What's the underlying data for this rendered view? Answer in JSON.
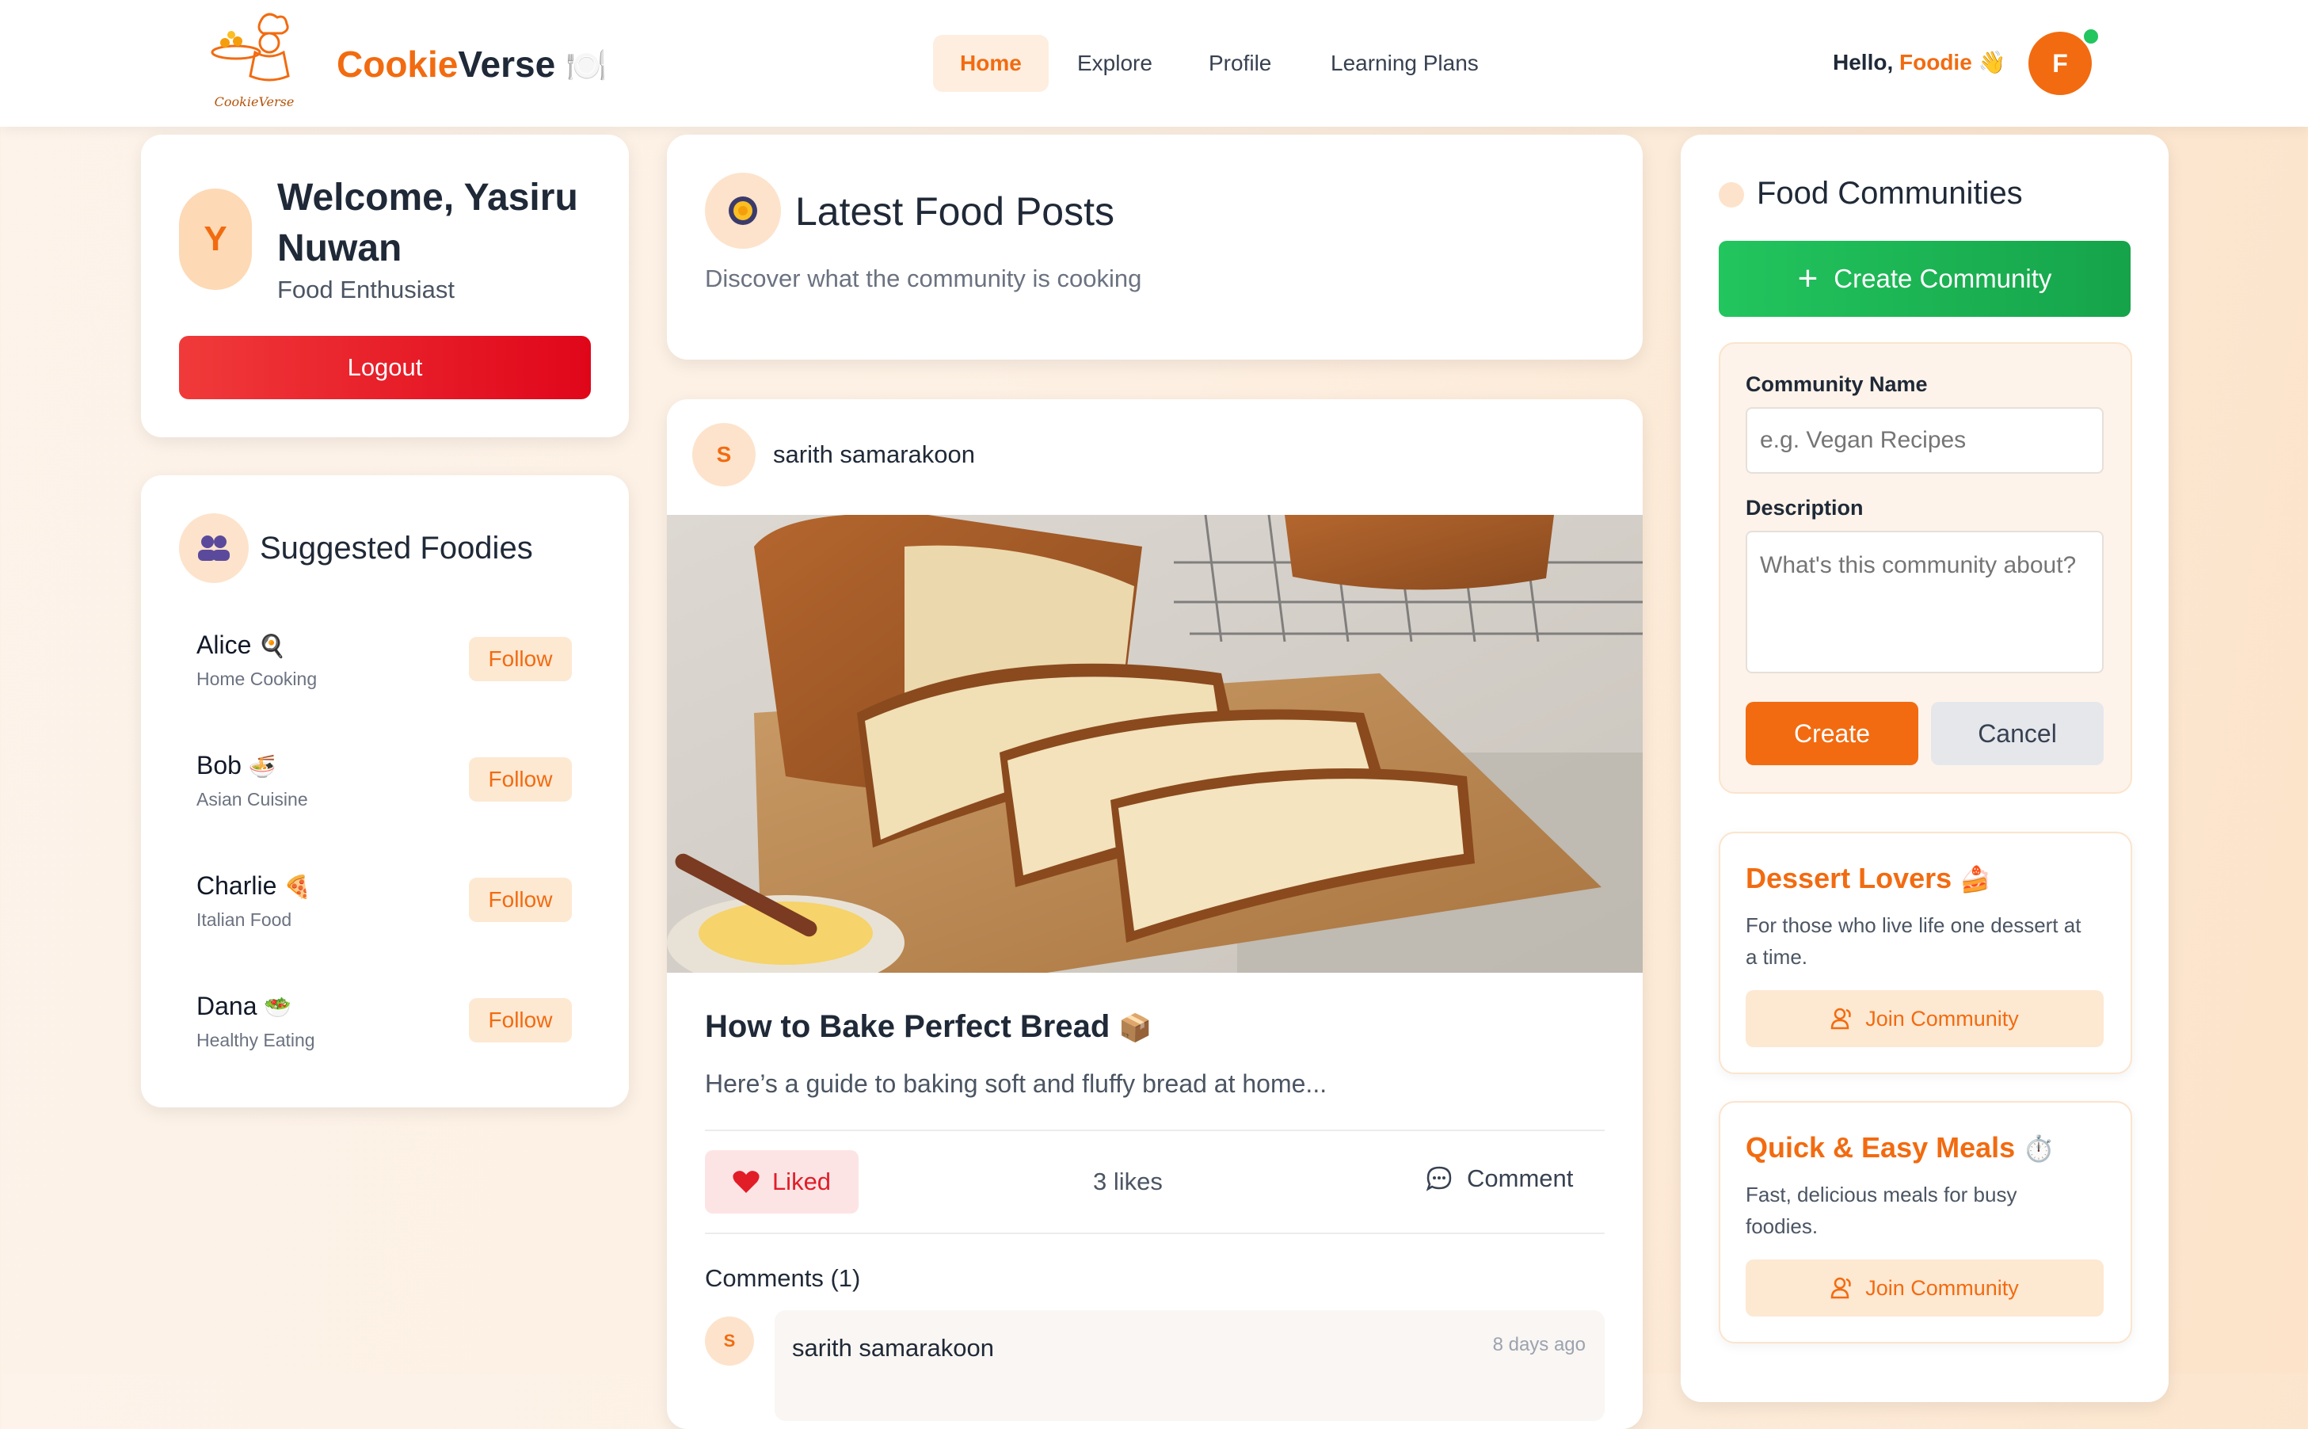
{
  "header": {
    "logo_caption": "CookieVerse",
    "brand_part1": "Cookie",
    "brand_part2": "Verse",
    "brand_emoji": "🍽️",
    "nav": [
      "Home",
      "Explore",
      "Profile",
      "Learning Plans"
    ],
    "greeting": "Hello,",
    "greeting_name": "Foodie",
    "greeting_emoji": "👋",
    "avatar_letter": "F"
  },
  "welcome": {
    "avatar_letter": "Y",
    "title": "Welcome, Yasiru Nuwan",
    "role": "Food Enthusiast",
    "logout": "Logout"
  },
  "suggested": {
    "title": "Suggested Foodies",
    "icon": "people-icon",
    "follow_label": "Follow",
    "items": [
      {
        "name": "Alice",
        "emoji": "🍳",
        "tag": "Home Cooking"
      },
      {
        "name": "Bob",
        "emoji": "🍜",
        "tag": "Asian Cuisine"
      },
      {
        "name": "Charlie",
        "emoji": "🍕",
        "tag": "Italian Food"
      },
      {
        "name": "Dana",
        "emoji": "🥗",
        "tag": "Healthy Eating"
      }
    ]
  },
  "feed": {
    "title": "Latest Food Posts",
    "subtitle": "Discover what the community is cooking",
    "icon": "pan-icon"
  },
  "post": {
    "author_letter": "S",
    "author": "sarith samarakoon",
    "title": "How to Bake Perfect Bread",
    "title_emoji": "📦",
    "excerpt": "Here’s a guide to baking soft and fluffy bread at home...",
    "liked_label": "Liked",
    "likes": "3 likes",
    "comment_label": "Comment",
    "comments_header": "Comments (1)",
    "comment": {
      "author_letter": "S",
      "author": "sarith samarakoon",
      "time": "8 days ago"
    }
  },
  "communities": {
    "title": "Food Communities",
    "create_button": "Create Community",
    "form": {
      "name_label": "Community Name",
      "name_placeholder": "e.g. Vegan Recipes",
      "desc_label": "Description",
      "desc_placeholder": "What's this community about?",
      "create": "Create",
      "cancel": "Cancel"
    },
    "items": [
      {
        "name": "Dessert Lovers",
        "emoji": "🍰",
        "desc": "For those who live life one dessert at a time.",
        "join": "Join Community"
      },
      {
        "name": "Quick & Easy Meals",
        "emoji": "⏱️",
        "desc": "Fast, delicious meals for busy foodies.",
        "join": "Join Community"
      }
    ]
  },
  "colors": {
    "accent": "#f26b10",
    "green": "#16a34a",
    "red": "#e11d28",
    "online": "#22c55e"
  }
}
